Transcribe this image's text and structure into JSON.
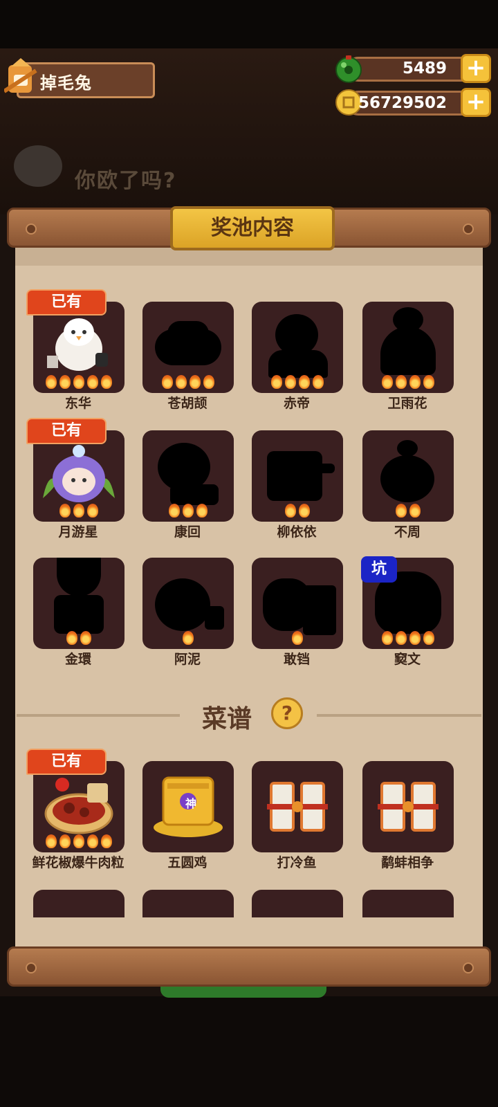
{
  "player": {
    "name": "掉毛兔"
  },
  "currency": {
    "jade": "5489",
    "coins": "56729502",
    "plus_symbol": "+"
  },
  "background": {
    "banner_text": "你欧了吗?"
  },
  "panel": {
    "title": "奖池内容"
  },
  "badges": {
    "owned": "已有",
    "pit": "坑"
  },
  "characters": [
    {
      "name": "东华",
      "stars": 5,
      "owned": true
    },
    {
      "name": "苍胡颉",
      "stars": 4
    },
    {
      "name": "赤帝",
      "stars": 4
    },
    {
      "name": "卫雨花",
      "stars": 4
    },
    {
      "name": "月游星",
      "stars": 3,
      "owned": true
    },
    {
      "name": "康回",
      "stars": 3
    },
    {
      "name": "柳依依",
      "stars": 2
    },
    {
      "name": "不周",
      "stars": 2
    },
    {
      "name": "金環",
      "stars": 2
    },
    {
      "name": "阿泥",
      "stars": 1
    },
    {
      "name": "敢铛",
      "stars": 1
    },
    {
      "name": "窫文",
      "stars": 4,
      "pit": true
    }
  ],
  "recipe_section": {
    "title": "菜谱",
    "help_symbol": "?"
  },
  "recipes": [
    {
      "name": "鲜花椒爆牛肉粒",
      "stars": 5,
      "owned": true,
      "style": "dish"
    },
    {
      "name": "五圆鸡",
      "stars": 0,
      "style": "gold",
      "emblem": "神"
    },
    {
      "name": "打冷鱼",
      "stars": 0,
      "style": "scroll"
    },
    {
      "name": "鹬蚌相争",
      "stars": 0,
      "style": "scroll"
    }
  ],
  "colors": {
    "panel": "#d8c2a6",
    "card": "#3a1f20",
    "owned_badge": "#e0451c",
    "pit_badge": "#1b24c6",
    "gold": "#f5c23a"
  }
}
